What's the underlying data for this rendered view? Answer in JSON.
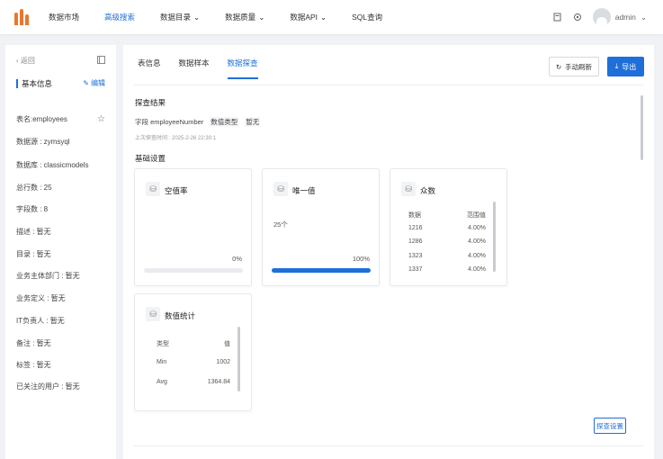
{
  "nav": {
    "items": [
      {
        "label": "数据市场",
        "dropdown": false
      },
      {
        "label": "高级搜索",
        "dropdown": false,
        "active": true
      },
      {
        "label": "数据目录",
        "dropdown": true
      },
      {
        "label": "数据质量",
        "dropdown": true
      },
      {
        "label": "数据API",
        "dropdown": true
      },
      {
        "label": "SQL查询",
        "dropdown": false
      }
    ],
    "user": "admin",
    "accent": "#1e6fd9",
    "logo_color": "#e8772e"
  },
  "left": {
    "back": "返回",
    "section_title": "基本信息",
    "edit": "编辑",
    "fields": [
      "表名:employees",
      "数据源 : zymsyql",
      "数据库 : classicmodels",
      "总行数 : 25",
      "字段数 : 8",
      "描述 : 暂无",
      "目录 : 暂无",
      "业务主体部门 : 暂无",
      "业务定义 : 暂无",
      "IT负责人 : 暂无",
      "备注 : 暂无",
      "标签 : 暂无",
      "已关注的用户 : 暂无"
    ]
  },
  "main": {
    "tabs": [
      "表信息",
      "数据样本",
      "数据探查"
    ],
    "active_tab": 2,
    "refresh": "手动刷新",
    "export": "导出",
    "result_title": "探查结果",
    "field_label": "字段 employeeNumber",
    "type_label": "数值类型",
    "type_value": "暂无",
    "last_time": "上次探查时间 : 2025-2-26 22:30:1",
    "basic_title": "基础设置",
    "cards": {
      "null_rate": {
        "title": "空值率",
        "percent": "0%",
        "fill": 0
      },
      "unique": {
        "title": "唯一值",
        "count": "25个",
        "percent": "100%",
        "fill": 1
      },
      "mode": {
        "title": "众数",
        "headers": [
          "数据",
          "范围值"
        ],
        "rows": [
          [
            "1216",
            "4.00%"
          ],
          [
            "1286",
            "4.00%"
          ],
          [
            "1323",
            "4.00%"
          ],
          [
            "1337",
            "4.00%"
          ]
        ]
      },
      "stats": {
        "title": "数值统计",
        "headers": [
          "类型",
          "值"
        ],
        "rows": [
          [
            "Min",
            "1002"
          ],
          [
            "Avg",
            "1364.84"
          ]
        ]
      }
    },
    "settings_button": "探查设置"
  }
}
